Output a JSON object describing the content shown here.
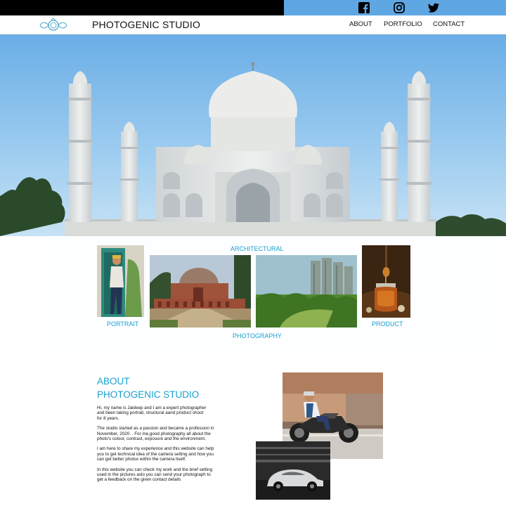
{
  "header": {
    "brand": "PHOTOGENIC STUDIO",
    "nav": [
      "ABOUT",
      "PORTFOLIO",
      "CONTACT"
    ],
    "social": [
      "facebook-icon",
      "instagram-icon",
      "twitter-icon"
    ]
  },
  "hero": {
    "subject": "Taj Mahal photograph"
  },
  "gallery": {
    "categories": {
      "architectural": "ARCHITECTURAL",
      "portrait": "PORTRAIT",
      "product": "PRODUCT",
      "photography": "PHOTOGRAPHY"
    }
  },
  "about": {
    "title": "ABOUT",
    "subtitle": "PHOTOGENIC STUDIO",
    "paragraphs": [
      "Hi, my name is Jaideep and I am a expert photographer\nand been taking portrait, structural aand product shoot\nfor 8 years.",
      "The studio started as a passion and became a profession in\nNovember, 2020. . For me,good photography all about the\nphoto's colour, contrast, exposure and the environment.",
      "I am here to share my experience and this website can help\nyou to get technical idea of the camera setting and how you\ncan get better photos within the camera itself.",
      "In this website you can check my work and the brief  setting\nused in the pictures aslo you can send your photograph to\nget a feedback on the given contact  details"
    ]
  },
  "colors": {
    "accent": "#1aa0cf",
    "topbar_blue": "#5fa7e3",
    "topbar_black": "#000000"
  }
}
